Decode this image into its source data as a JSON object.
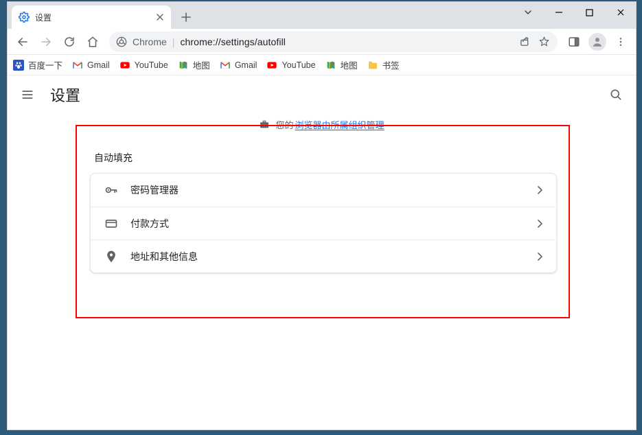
{
  "window": {
    "tab_title": "设置",
    "new_tab_glyph": "＋"
  },
  "toolbar": {
    "omnibox_prefix": "Chrome",
    "omnibox_url": "chrome://settings/autofill"
  },
  "bookmarks": [
    {
      "label": "百度一下",
      "icon": "baidu"
    },
    {
      "label": "Gmail",
      "icon": "gmail"
    },
    {
      "label": "YouTube",
      "icon": "youtube"
    },
    {
      "label": "地图",
      "icon": "maps"
    },
    {
      "label": "Gmail",
      "icon": "gmail"
    },
    {
      "label": "YouTube",
      "icon": "youtube"
    },
    {
      "label": "地图",
      "icon": "maps"
    },
    {
      "label": "书签",
      "icon": "folder"
    }
  ],
  "settings": {
    "title": "设置",
    "managed_prefix": "您的",
    "managed_link": "浏览器由所属组织管理",
    "section_title": "自动填充",
    "rows": [
      {
        "label": "密码管理器",
        "icon": "key"
      },
      {
        "label": "付款方式",
        "icon": "card"
      },
      {
        "label": "地址和其他信息",
        "icon": "location"
      }
    ]
  }
}
